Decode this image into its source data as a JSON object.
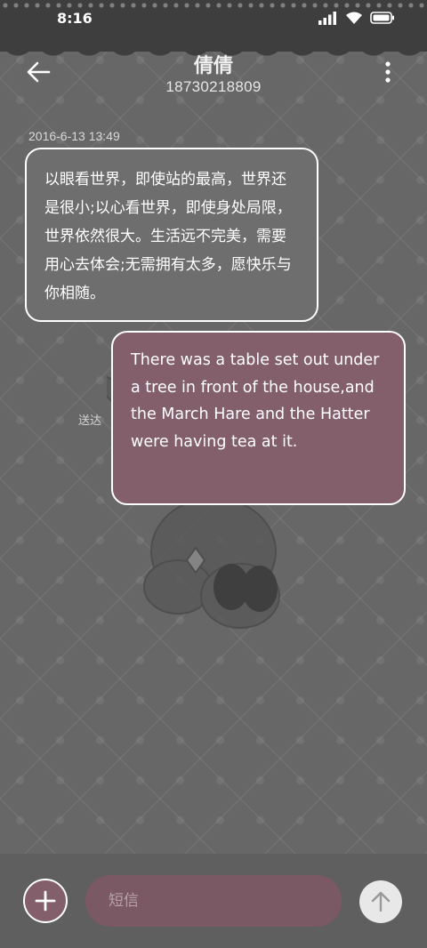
{
  "status_bar": {
    "time": "8:16",
    "icons": [
      "signal-icon",
      "wifi-icon",
      "battery-icon"
    ]
  },
  "header": {
    "contact_name": "倩倩",
    "phone_number": "18730218809",
    "back_icon": "arrow-left-icon",
    "menu_icon": "more-vertical-icon"
  },
  "messages": [
    {
      "direction": "incoming",
      "timestamp": "2016-6-13 13:49",
      "text": "以眼看世界，即使站的最高，世界还是很小;以心看世界，即使身处局限，世界依然很大。生活远不完美，需要用心去体会;无需拥有太多，愿快乐与你相随。"
    },
    {
      "direction": "outgoing",
      "status": "送达",
      "text": "There was a table set out under a tree in front of the house,and the March Hare and the Hatter were having tea at it."
    }
  ],
  "compose": {
    "placeholder": "短信",
    "value": "",
    "add_icon": "plus-icon",
    "send_icon": "arrow-up-icon"
  },
  "colors": {
    "accent": "#835f6b",
    "background": "#676767",
    "bubble_incoming": "#6e6e6e",
    "bubble_border": "#ffffff"
  }
}
